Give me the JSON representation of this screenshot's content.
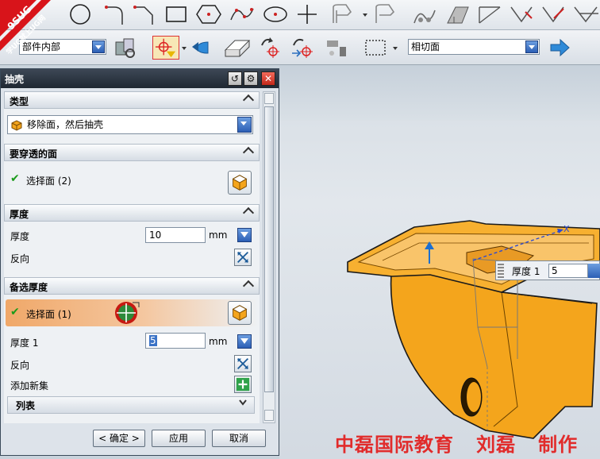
{
  "toolbar2": {
    "filter_combo": "部件内部",
    "face_rule_combo": "相切面"
  },
  "logo": {
    "line1": "9SUG",
    "line2": "学UG就上UG网"
  },
  "dialog": {
    "title": "抽壳",
    "sections": {
      "type": {
        "header": "类型",
        "selected": "移除面，然后抽壳"
      },
      "pierce_faces": {
        "header": "要穿透的面",
        "select_label": "选择面 (2)"
      },
      "thickness": {
        "header": "厚度",
        "thickness_label": "厚度",
        "thickness_value": "10",
        "unit": "mm",
        "reverse_label": "反向"
      },
      "alt_thickness": {
        "header": "备选厚度",
        "select_label": "选择面 (1)",
        "thickness_label": "厚度 1",
        "thickness_value": "5",
        "unit": "mm",
        "reverse_label": "反向",
        "add_set_label": "添加新集",
        "list_label": "列表"
      }
    },
    "buttons": {
      "ok": "< 确定 >",
      "apply": "应用",
      "cancel": "取消"
    }
  },
  "graphics": {
    "popup_label": "厚度 1",
    "popup_value": "5",
    "axis_x": "X",
    "credit": "中磊国际教育   刘磊   制作"
  },
  "colors": {
    "part_orange": "#f4a51c",
    "title_bar": "#2a3440",
    "highlight_row": "#f0a869",
    "credit_red": "#e12b2b"
  }
}
